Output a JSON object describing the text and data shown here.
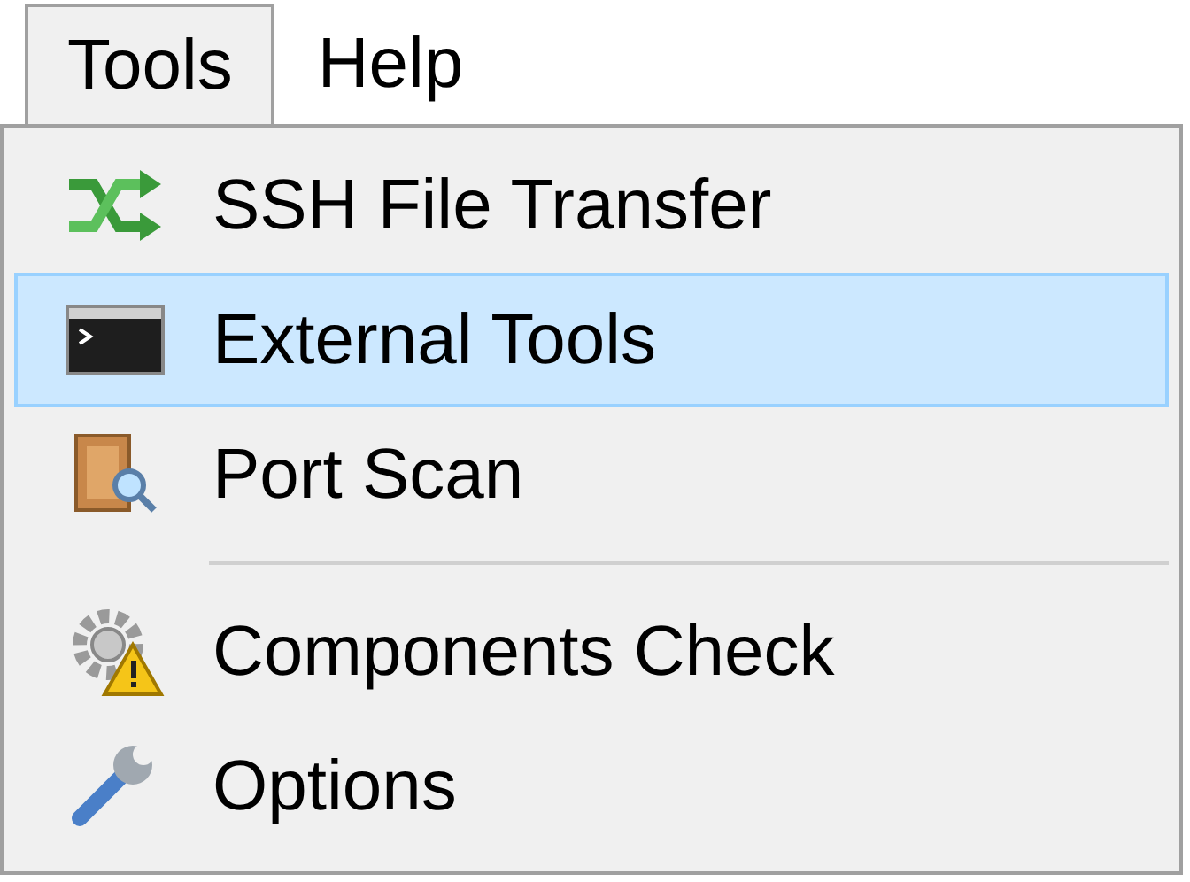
{
  "menu_bar": [
    {
      "label": "Tools",
      "selected": true
    },
    {
      "label": "Help",
      "selected": false
    }
  ],
  "menu": [
    {
      "kind": "item",
      "label": "SSH File Transfer",
      "selected": false
    },
    {
      "kind": "item",
      "label": "External Tools",
      "selected": true
    },
    {
      "kind": "item",
      "label": "Port Scan",
      "selected": false
    },
    {
      "kind": "separator"
    },
    {
      "kind": "item",
      "label": "Components Check",
      "selected": false
    },
    {
      "kind": "item",
      "label": "Options",
      "selected": false
    }
  ]
}
